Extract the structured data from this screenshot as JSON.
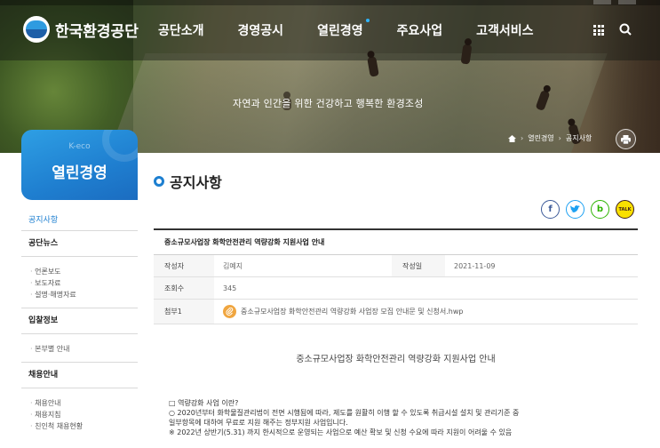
{
  "header": {
    "org_name": "한국환경공단",
    "nav": [
      "공단소개",
      "경영공시",
      "열린경영",
      "주요사업",
      "고객서비스"
    ],
    "active_nav_index": 2,
    "slogan": "자연과 인간을 위한 건강하고 행복한 환경조성"
  },
  "breadcrumb": {
    "items": [
      "열린경영",
      "공지사항"
    ]
  },
  "sidebar": {
    "brand_en": "K-eco",
    "title": "열린경영",
    "active_item": "공지사항",
    "groups": [
      {
        "label": "공단뉴스",
        "items": [
          "언론보도",
          "보도자료",
          "설명·해명자료"
        ]
      },
      {
        "label": "입찰정보",
        "items": [
          "본부별 안내"
        ]
      },
      {
        "label": "채용안내",
        "items": [
          "채용안내",
          "채용지침",
          "친인척 채용현황"
        ]
      }
    ]
  },
  "main": {
    "page_title": "공지사항",
    "share": {
      "facebook": "f",
      "twitter": "t",
      "blog": "b",
      "talk": "TALK"
    },
    "post": {
      "title": "중소규모사업장 화학안전관리 역량강화 지원사업 안내",
      "author_label": "작성자",
      "author": "김예지",
      "date_label": "작성일",
      "date": "2021-11-09",
      "views_label": "조회수",
      "views": "345",
      "attach_label": "첨부1",
      "attachment": "중소규모사업장 화학안전관리 역량강화 사업장 모집 안내문 및 신청서.hwp"
    },
    "content": {
      "heading": "중소규모사업장 화학안전관리 역량강화 지원사업 안내",
      "lines": [
        "□ 역량강화 사업 이란?",
        " ○ 2020년부터 화학물질관리법이 전면 시행됨에 따라, 제도를 원활히 이행 할 수 있도록 취급시설 설치 및 관리기준 중",
        "   일부항목에 대하여 무료로 지원 해주는 정부지원 사업입니다.",
        "   ※ 2022년 상반기(5.31) 까지 한시적으로 운영되는 사업으로 예산 확보 및 신청 수요에 따라 지원이 어려울 수 있음"
      ]
    }
  },
  "colors": {
    "accent": "#1d7fd0",
    "facebook": "#3b5998",
    "twitter": "#1da1f2",
    "blog": "#2db400",
    "talk": "#3c1e1e",
    "attach": "#f0a640"
  }
}
